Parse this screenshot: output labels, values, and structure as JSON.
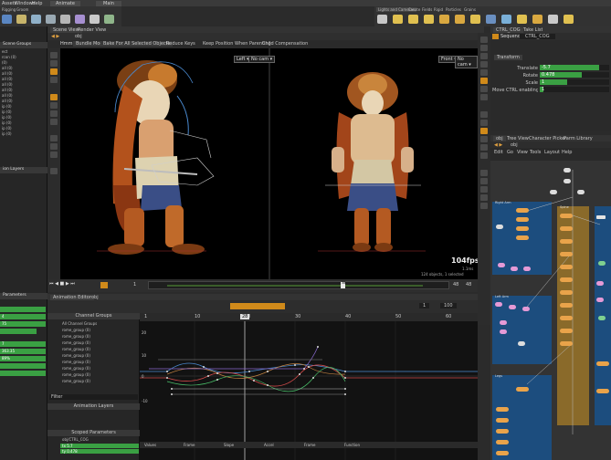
{
  "menubar": {
    "items": [
      "Assets",
      "Windows",
      "Help"
    ],
    "desktop": "Animate",
    "context": "Main"
  },
  "shelf_left": {
    "tabs": [
      "Rigging",
      "Groom"
    ],
    "tools": [
      "Apply",
      "Rig Tools",
      "Point/Bone",
      "Bone",
      "Build Rig",
      "Pose",
      "Stick",
      "Go Bas"
    ]
  },
  "shelf_right": {
    "tabs": [
      "Lights and Cameras",
      "Create",
      "Fields",
      "Rigid",
      "Particles",
      "Grains"
    ],
    "tools": [
      "Camera",
      "Point Light",
      "Spot Light",
      "Area Light",
      "Geometry Light",
      "Volume Light",
      "Distant Light",
      "Environment Light",
      "Sky Light",
      "GI Light",
      "Caustic Light",
      "Portal Light",
      "Ambient Light"
    ]
  },
  "left_panel": {
    "header": "Scene Groups",
    "rows": [
      "ect",
      "rcon (0)",
      "(0)",
      "all (0)",
      "all (0)",
      "all (0)",
      "all (0)",
      "all (0)",
      "all (0)",
      "all (0)",
      "ip (0)",
      "ip (0)",
      "ip (0)",
      "ip (0)",
      "ip (0)",
      "ip (0)"
    ],
    "layers_header": "ion Layers",
    "params_header": "Parameters",
    "param_rows": [
      {
        "label": "",
        "value": ""
      },
      {
        "label": "4",
        "value": ""
      },
      {
        "label": "75",
        "value": ""
      },
      {
        "label": "",
        "value": ""
      },
      {
        "label": "7",
        "value": ""
      },
      {
        "label": "363.35",
        "value": ""
      },
      {
        "label": "89%",
        "value": ""
      },
      {
        "label": "",
        "value": ""
      },
      {
        "label": "",
        "value": ""
      }
    ]
  },
  "viewport": {
    "tabs": [
      "Scene View",
      "Render View"
    ],
    "path": "obj",
    "toolbar": {
      "mode": "Hmm",
      "opt1": "Bundle Mode",
      "opt2": "Bake For All Selected Objects",
      "chk1": "Reduce Keys",
      "chk2": "Keep Position When Parenting",
      "chk3": "Child Compensation"
    },
    "left_view": {
      "labels": [
        "Left ▾",
        "No cam ▾"
      ]
    },
    "right_view": {
      "labels": [
        "Front ▾",
        "No cam ▾"
      ]
    },
    "fps": "104fps",
    "fps_sub": "1.1ms",
    "status": "124 objects, 1 selected"
  },
  "timeline": {
    "start": "1",
    "end": "48",
    "current": "38",
    "range_end": "48",
    "ticks": [
      "12",
      "24",
      "36",
      "48"
    ]
  },
  "anim_editor": {
    "tabs": [
      "Animation Editor",
      "obj"
    ],
    "frame_start": "1",
    "frame_end": "100",
    "ruler": [
      "1",
      "10",
      "20",
      "30",
      "40",
      "50",
      "60"
    ],
    "current": "28",
    "channel_groups_header": "Channel Groups",
    "channel_groups": [
      "All Channel Groups",
      "rome_group (0)",
      "rome_group (0)",
      "rome_group (0)",
      "rome_group (0)",
      "rome_group (0)",
      "rome_group (0)",
      "rome_group (0)",
      "rome_group (0)",
      "rome_group (0)"
    ],
    "filter": "Filter",
    "anim_layers_header": "Animation Layers",
    "scoped_header": "Scoped Parameters",
    "scoped": [
      "obj/CTRL_COG",
      "tx  5.7",
      "ty  0.478"
    ],
    "yticks": [
      "20",
      "10",
      "0",
      "-10"
    ],
    "bottom_tabs": [
      "Values",
      "Frame",
      "Slope",
      "Accel",
      "Frame",
      "Function"
    ]
  },
  "right_panel": {
    "tabs": [
      "CTRL_COG",
      "Take List"
    ],
    "node_label": "Sequence",
    "node_name": "CTRL_COG",
    "section": "Transform",
    "params": [
      {
        "name": "Translate",
        "value": "-5.7",
        "fill": 0.85
      },
      {
        "name": "Rotate",
        "value": "0.478",
        "fill": 0.6
      },
      {
        "name": "Scale",
        "value": "1",
        "fill": 0.4
      },
      {
        "name": "Move CTRL enabling",
        "value": "1",
        "fill": 0.05
      }
    ],
    "network_tabs": [
      "obj",
      "Tree View",
      "Character Picker",
      "Parm Library"
    ],
    "network_path": "obj",
    "network_menu": [
      "Edit",
      "Go",
      "View",
      "Tools",
      "Layout",
      "Help"
    ],
    "netboxes": [
      "Right Arm",
      "Left Arm",
      "Spine",
      "Legs"
    ]
  },
  "colors": {
    "accent": "#d08a1a",
    "green": "#3aa043",
    "node_orange": "#e9a34a",
    "net_blue": "#1c4d7e"
  }
}
